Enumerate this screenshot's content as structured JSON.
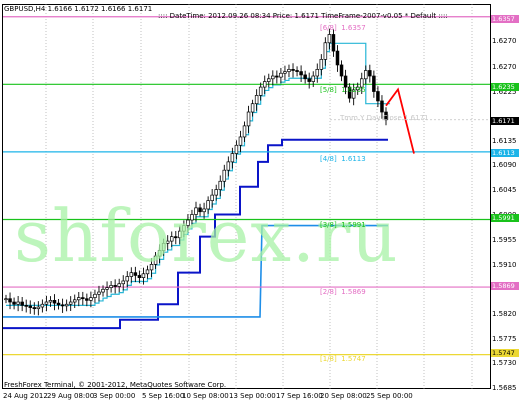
{
  "header": {
    "symbol_info": "GBPUSD,H4  1.6166 1.6172 1.6166 1.6171",
    "info_line": ":::: DateTime: 2012.09.26 08:34   Price: 1.6171   TimeFrame-2007-v0.05    *   Default   ::::"
  },
  "footer": {
    "copyright": "FreshForex Terminal, © 2001-2012, MetaQuotes Software Corp."
  },
  "watermark": "shforex.ru",
  "y_axis": {
    "ticks": [
      "1.6270",
      "1.6225",
      "1.6135",
      "1.6090",
      "1.6045",
      "1.6000",
      "1.5955",
      "1.5910",
      "1.5820",
      "1.5775",
      "1.5730",
      "1.5685"
    ]
  },
  "x_axis": {
    "ticks": [
      "24 Aug 2012",
      "29 Aug 08:00",
      "3 Sep 00:00",
      "5 Sep 16:00",
      "10 Sep 08:00",
      "13 Sep 00:00",
      "17 Sep 16:00",
      "20 Sep 08:00",
      "25 Sep 00:00"
    ]
  },
  "murrey_levels": [
    {
      "label": "[6/8]",
      "value": "1.6357",
      "color": "#e36fc4"
    },
    {
      "label": "[5/8]",
      "value": "1.6235",
      "color": "#19c21b"
    },
    {
      "label": "[4/8]",
      "value": "1.6113",
      "color": "#1cb4e8"
    },
    {
      "label": "[3/8]",
      "value": "1.5991",
      "color": "#19c21b"
    },
    {
      "label": "[2/8]",
      "value": "1.5869",
      "color": "#e36fc4"
    },
    {
      "label": "[1/8]",
      "value": "1.5747",
      "color": "#ecd834"
    }
  ],
  "price_tags": [
    {
      "value": "1.6357",
      "bg": "#e36fc4"
    },
    {
      "value": "1.6235",
      "bg": "#19c21b"
    },
    {
      "value": "1.6171",
      "bg": "#000000"
    },
    {
      "value": "1.6113",
      "bg": "#1cb4e8"
    },
    {
      "value": "1.5991",
      "bg": "#19c21b"
    },
    {
      "value": "1.5869",
      "bg": "#e36fc4"
    },
    {
      "value": "1.5747",
      "bg": "#ecd834"
    }
  ],
  "ghost_label": "Tmm Y Day Close 1.6171",
  "colors": {
    "candle": "#000000",
    "forecast_arrow": "#ff0000",
    "trail_light": "#27b6d6",
    "trail_dark": "#0a14c8",
    "trail_mid": "#1e8ee8"
  },
  "chart_data": {
    "type": "line",
    "instrument": "GBPUSD",
    "timeframe": "H4",
    "ylim": [
      1.5685,
      1.638
    ],
    "price": [
      1.5848,
      1.5842,
      1.5838,
      1.5842,
      1.5836,
      1.5835,
      1.5832,
      1.583,
      1.5833,
      1.5838,
      1.5842,
      1.5845,
      1.584,
      1.5837,
      1.5835,
      1.5838,
      1.5842,
      1.5846,
      1.585,
      1.5848,
      1.5845,
      1.585,
      1.5856,
      1.586,
      1.5865,
      1.5868,
      1.5872,
      1.587,
      1.5875,
      1.588,
      1.5888,
      1.5895,
      1.589,
      1.5886,
      1.5893,
      1.59,
      1.591,
      1.5925,
      1.5935,
      1.5948,
      1.5952,
      1.596,
      1.5958,
      1.597,
      1.598,
      1.599,
      1.6,
      1.6012,
      1.6005,
      1.601,
      1.6025,
      1.6035,
      1.6045,
      1.606,
      1.608,
      1.6095,
      1.611,
      1.6125,
      1.614,
      1.616,
      1.6185,
      1.62,
      1.6215,
      1.623,
      1.624,
      1.6245,
      1.625,
      1.6248,
      1.6255,
      1.6258,
      1.6262,
      1.626,
      1.6258,
      1.6252,
      1.6245,
      1.624,
      1.625,
      1.6262,
      1.628,
      1.631,
      1.6325,
      1.6295,
      1.627,
      1.625,
      1.623,
      1.621,
      1.6225,
      1.623,
      1.6245,
      1.626,
      1.625,
      1.6222,
      1.6205,
      1.6185,
      1.6171
    ],
    "levels": [
      1.6357,
      1.6235,
      1.6113,
      1.5991,
      1.5869,
      1.5747
    ],
    "forecast": {
      "from": 1.62,
      "peak": 1.6215,
      "to": 1.611
    }
  }
}
